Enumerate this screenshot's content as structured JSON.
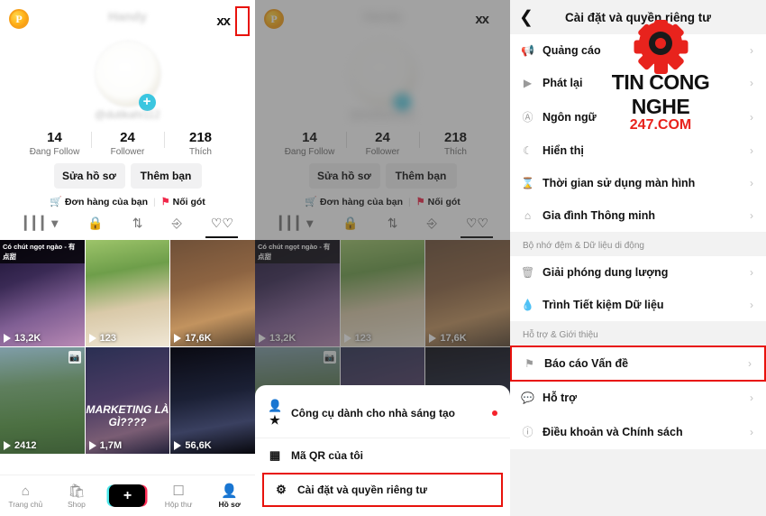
{
  "profile": {
    "coin_label": "P",
    "username_blurred": "Handy",
    "handle_blurred": "@dutikahi112",
    "header_icons": {
      "footprint": "footprint-icon",
      "menu": "hamburger-menu-icon"
    },
    "stats": [
      {
        "num": "14",
        "label": "Đang Follow"
      },
      {
        "num": "24",
        "label": "Follower"
      },
      {
        "num": "218",
        "label": "Thích"
      }
    ],
    "buttons": [
      {
        "label": "Sửa hồ sơ"
      },
      {
        "label": "Thêm bạn"
      }
    ],
    "quick_links": [
      {
        "icon": "cart-icon",
        "label": "Đơn hàng của bạn"
      },
      {
        "icon": "first-aid-icon",
        "label": "Nối gót"
      }
    ],
    "tabs": [
      {
        "icon": "grid-icon",
        "name": "tab-grid",
        "selected": false
      },
      {
        "icon": "lock-icon",
        "name": "tab-private",
        "selected": false
      },
      {
        "icon": "repost-icon",
        "name": "tab-repost",
        "selected": false
      },
      {
        "icon": "tagged-icon",
        "name": "tab-tagged",
        "selected": false
      },
      {
        "icon": "heart-icon",
        "name": "tab-liked",
        "selected": true
      }
    ],
    "videos": [
      {
        "views": "13,2K",
        "caption": "Có chút ngọt ngào - 有点甜",
        "art": "art1"
      },
      {
        "views": "123",
        "caption": "",
        "art": "art2"
      },
      {
        "views": "17,6K",
        "caption": "",
        "art": "art3"
      },
      {
        "views": "2412",
        "caption": "",
        "art": "art4",
        "pinned": true
      },
      {
        "views": "1,7M",
        "caption": "",
        "art": "art5",
        "overlay": "MARKETING LÀ GÌ????"
      },
      {
        "views": "56,6K",
        "caption": "",
        "art": "art6"
      }
    ],
    "bottom_nav": [
      {
        "icon": "home-icon",
        "label": "Trang chủ",
        "selected": false
      },
      {
        "icon": "shop-bag-icon",
        "label": "Shop",
        "selected": false
      },
      {
        "icon": "plus-icon",
        "label": "",
        "selected": false
      },
      {
        "icon": "inbox-icon",
        "label": "Hộp thư",
        "selected": false
      },
      {
        "icon": "person-icon",
        "label": "Hồ sơ",
        "selected": true
      }
    ]
  },
  "popup_menu": {
    "items": [
      {
        "icon": "creator-tools-icon",
        "label": "Công cụ dành cho nhà sáng tạo",
        "badge": true,
        "highlighted": false
      },
      {
        "icon": "qr-code-icon",
        "label": "Mã QR của tôi",
        "badge": false,
        "highlighted": false
      },
      {
        "icon": "gear-icon",
        "label": "Cài đặt và quyền riêng tư",
        "badge": false,
        "highlighted": true
      }
    ]
  },
  "settings": {
    "back_icon": "back-chevron-icon",
    "title": "Cài đặt và quyền riêng tư",
    "groups": [
      {
        "section": "",
        "rows": [
          {
            "icon": "megaphone-icon",
            "label": "Quảng cáo",
            "highlighted": false
          },
          {
            "icon": "play-box-icon",
            "label": "Phát lại",
            "highlighted": false
          },
          {
            "icon": "language-a-icon",
            "label": "Ngôn ngữ",
            "highlighted": false
          },
          {
            "icon": "moon-icon",
            "label": "Hiển thị",
            "highlighted": false
          },
          {
            "icon": "hourglass-icon",
            "label": "Thời gian sử dụng màn hình",
            "highlighted": false
          },
          {
            "icon": "house-icon",
            "label": "Gia đình Thông minh",
            "highlighted": false
          }
        ]
      },
      {
        "section": "Bộ nhớ đệm & Dữ liệu di động",
        "rows": [
          {
            "icon": "trash-icon",
            "label": "Giải phóng dung lượng",
            "highlighted": false
          },
          {
            "icon": "water-drop-icon",
            "label": "Trình Tiết kiệm Dữ liệu",
            "highlighted": false
          }
        ]
      },
      {
        "section": "Hỗ trợ & Giới thiệu",
        "rows": [
          {
            "icon": "flag-icon",
            "label": "Báo cáo Vấn đề",
            "highlighted": true
          },
          {
            "icon": "chat-bubble-icon",
            "label": "Hỗ trợ",
            "highlighted": false
          },
          {
            "icon": "info-icon",
            "label": "Điều khoản và Chính sách",
            "highlighted": false
          }
        ]
      }
    ],
    "chevron": "›"
  },
  "watermark": {
    "line1": "TIN CONG NGHE",
    "line2": "247.COM",
    "gear_color": "#e8231d"
  },
  "colors": {
    "highlight_red": "#e8120c",
    "accent_pink": "#fe2c55",
    "accent_cyan": "#4de8eb"
  }
}
